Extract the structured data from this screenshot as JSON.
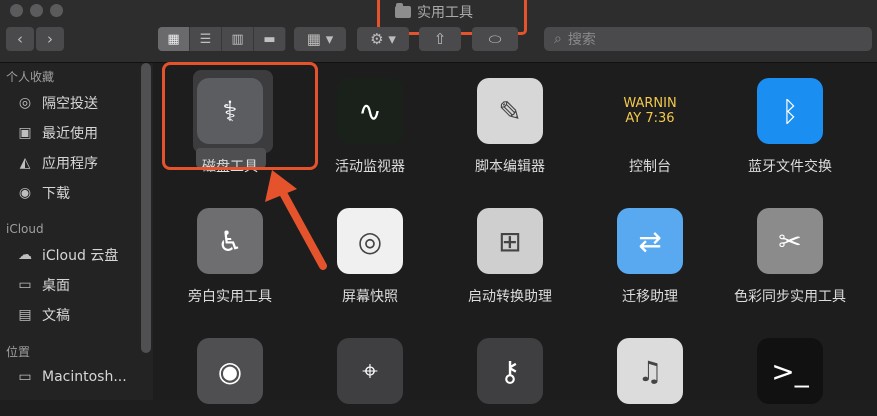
{
  "window": {
    "title": "实用工具"
  },
  "toolbar": {
    "back_icon": "chevron-left-icon",
    "forward_icon": "chevron-right-icon",
    "view_modes": [
      "icon-grid",
      "list",
      "columns",
      "gallery"
    ],
    "group_label": "▦ ▾",
    "action_label": "⚙ ▾",
    "search_placeholder": "搜索"
  },
  "sidebar": {
    "favorites_title": "个人收藏",
    "favorites": [
      {
        "label": "隔空投送",
        "icon": "airdrop-icon"
      },
      {
        "label": "最近使用",
        "icon": "recent-icon"
      },
      {
        "label": "应用程序",
        "icon": "applications-icon"
      },
      {
        "label": "下载",
        "icon": "download-icon"
      }
    ],
    "icloud_title": "iCloud",
    "icloud": [
      {
        "label": "iCloud 云盘",
        "icon": "cloud-icon"
      },
      {
        "label": "桌面",
        "icon": "desktop-icon"
      },
      {
        "label": "文稿",
        "icon": "document-icon"
      }
    ],
    "locations_title": "位置",
    "locations": [
      {
        "label": "Macintosh...",
        "icon": "disk-icon"
      }
    ]
  },
  "apps": [
    {
      "label": "磁盘工具",
      "icon": "disk-utility-icon",
      "color": "#5b5d60",
      "symbol": "⚕"
    },
    {
      "label": "活动监视器",
      "icon": "activity-monitor-icon",
      "color": "#19211a",
      "symbol": "∿"
    },
    {
      "label": "脚本编辑器",
      "icon": "script-editor-icon",
      "color": "#d7d7d7",
      "symbol": "✎"
    },
    {
      "label": "控制台",
      "icon": "console-icon",
      "color": "#1d1d1d",
      "symbol": "WARNIN\nAY 7:36"
    },
    {
      "label": "蓝牙文件交换",
      "icon": "bluetooth-icon",
      "color": "#1b8ef2",
      "symbol": "ᛒ"
    },
    {
      "label": "旁白实用工具",
      "icon": "voiceover-icon",
      "color": "#6e6e70",
      "symbol": "♿"
    },
    {
      "label": "屏幕快照",
      "icon": "screenshot-icon",
      "color": "#f0f0f0",
      "symbol": "◎"
    },
    {
      "label": "启动转换助理",
      "icon": "boot-camp-icon",
      "color": "#cfcfcf",
      "symbol": "⊞"
    },
    {
      "label": "迁移助理",
      "icon": "migration-icon",
      "color": "#59a9f0",
      "symbol": "⇄"
    },
    {
      "label": "色彩同步实用工具",
      "icon": "colorsync-icon",
      "color": "#8b8b8b",
      "symbol": "✂"
    },
    {
      "label": "",
      "icon": "digital-color-meter-icon",
      "color": "#4f4f51",
      "symbol": "◉"
    },
    {
      "label": "",
      "icon": "system-information-icon",
      "color": "#3f3f41",
      "symbol": "⌖"
    },
    {
      "label": "",
      "icon": "keychain-icon",
      "color": "#3f3f41",
      "symbol": "⚷"
    },
    {
      "label": "",
      "icon": "audio-midi-icon",
      "color": "#dcdcdc",
      "symbol": "♫"
    },
    {
      "label": "",
      "icon": "terminal-icon",
      "color": "#111111",
      "symbol": ">_"
    }
  ]
}
